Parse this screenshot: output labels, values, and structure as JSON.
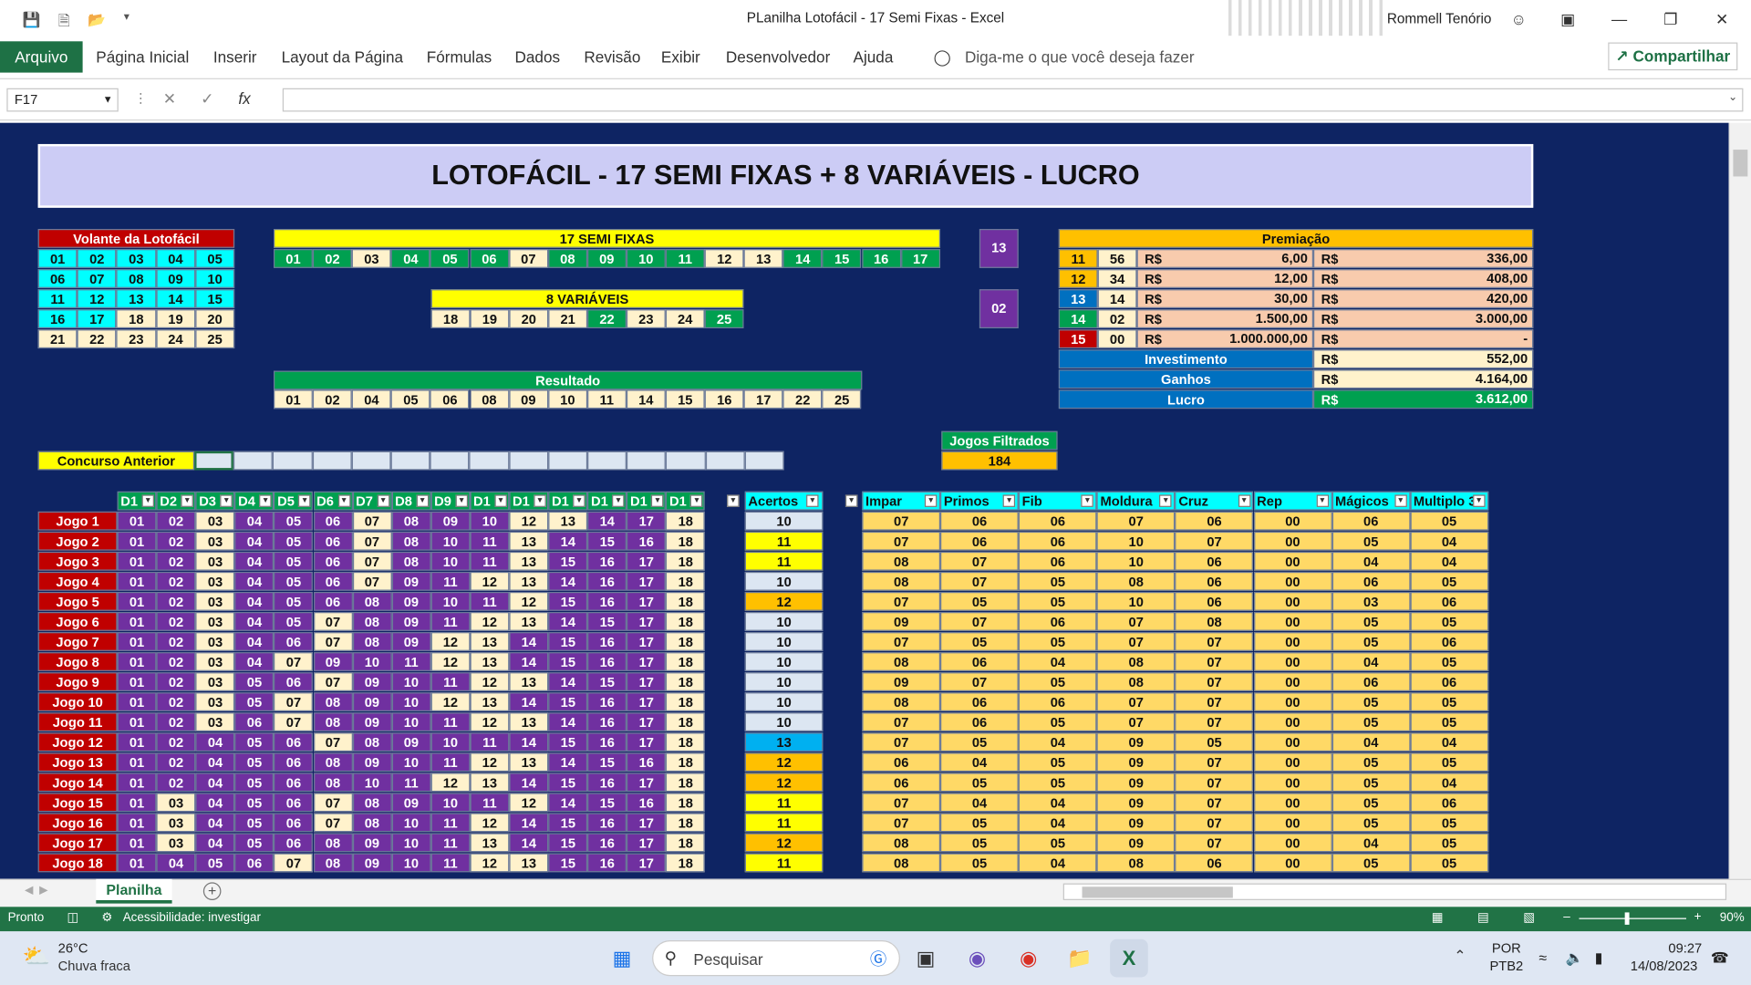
{
  "window": {
    "title": "PLanilha Lotofácil - 17 Semi Fixas  -  Excel",
    "user": "Rommell Tenório"
  },
  "ribbon": {
    "tabs": [
      "Arquivo",
      "Página Inicial",
      "Inserir",
      "Layout da Página",
      "Fórmulas",
      "Dados",
      "Revisão",
      "Exibir",
      "Desenvolvedor",
      "Ajuda"
    ],
    "tell_me": "Diga-me o que você deseja fazer",
    "share": "Compartilhar"
  },
  "formula_bar": {
    "name_box": "F17",
    "fx": "fx",
    "content": ""
  },
  "banner": "LOTOFÁCIL - 17 SEMI FIXAS + 8 VARIÁVEIS - LUCRO",
  "volante": {
    "title": "Volante da Lotofácil",
    "rows": [
      [
        "01",
        "02",
        "03",
        "04",
        "05"
      ],
      [
        "06",
        "07",
        "08",
        "09",
        "10"
      ],
      [
        "11",
        "12",
        "13",
        "14",
        "15"
      ],
      [
        "16",
        "17",
        "18",
        "19",
        "20"
      ],
      [
        "21",
        "22",
        "23",
        "24",
        "25"
      ]
    ],
    "colors": [
      [
        "c",
        "c",
        "c",
        "c",
        "c"
      ],
      [
        "c",
        "c",
        "c",
        "c",
        "c"
      ],
      [
        "c",
        "c",
        "c",
        "c",
        "c"
      ],
      [
        "c",
        "c",
        "l",
        "l",
        "l"
      ],
      [
        "l",
        "l",
        "l",
        "l",
        "l"
      ]
    ]
  },
  "semi_fixas": {
    "title": "17 SEMI FIXAS",
    "numbers": [
      "01",
      "02",
      "03",
      "04",
      "05",
      "06",
      "07",
      "08",
      "09",
      "10",
      "11",
      "12",
      "13",
      "14",
      "15",
      "16",
      "17"
    ],
    "colors": [
      "g",
      "g",
      "l",
      "g",
      "g",
      "g",
      "l",
      "g",
      "g",
      "g",
      "g",
      "l",
      "l",
      "g",
      "g",
      "g",
      "g"
    ]
  },
  "variaveis": {
    "title": "8 VARIÁVEIS",
    "numbers": [
      "18",
      "19",
      "20",
      "21",
      "22",
      "23",
      "24",
      "25"
    ],
    "colors": [
      "l",
      "l",
      "l",
      "l",
      "g",
      "l",
      "l",
      "g"
    ]
  },
  "resultado": {
    "title": "Resultado",
    "numbers": [
      "01",
      "02",
      "04",
      "05",
      "06",
      "08",
      "09",
      "10",
      "11",
      "14",
      "15",
      "16",
      "17",
      "22",
      "25"
    ]
  },
  "side_counts": {
    "a": "13",
    "b": "02"
  },
  "premiacao": {
    "title": "Premiação",
    "rows": [
      {
        "hits": "11",
        "qty": "56",
        "cur1": "R$",
        "prize": "6,00",
        "cur2": "R$",
        "total": "336,00",
        "color": "orange"
      },
      {
        "hits": "12",
        "qty": "34",
        "cur1": "R$",
        "prize": "12,00",
        "cur2": "R$",
        "total": "408,00",
        "color": "orange"
      },
      {
        "hits": "13",
        "qty": "14",
        "cur1": "R$",
        "prize": "30,00",
        "cur2": "R$",
        "total": "420,00",
        "color": "blue"
      },
      {
        "hits": "14",
        "qty": "02",
        "cur1": "R$",
        "prize": "1.500,00",
        "cur2": "R$",
        "total": "3.000,00",
        "color": "green"
      },
      {
        "hits": "15",
        "qty": "00",
        "cur1": "R$",
        "prize": "1.000.000,00",
        "cur2": "R$",
        "total": "-",
        "color": "red"
      }
    ],
    "summary": [
      {
        "label": "Investimento",
        "cur": "R$",
        "value": "552,00"
      },
      {
        "label": "Ganhos",
        "cur": "R$",
        "value": "4.164,00"
      },
      {
        "label": "Lucro",
        "cur": "R$",
        "value": "3.612,00"
      }
    ]
  },
  "jogos_filtrados": {
    "label": "Jogos Filtrados",
    "value": "184"
  },
  "concurso_anterior": "Concurso Anterior",
  "table": {
    "d_headers": [
      "D1",
      "D2",
      "D3",
      "D4",
      "D5",
      "D6",
      "D7",
      "D8",
      "D9",
      "D1",
      "D1",
      "D1",
      "D1",
      "D1",
      "D1"
    ],
    "acertos_header": "Acertos",
    "stat_headers": [
      "Impar",
      "Primos",
      "Fib",
      "Moldura",
      "Cruz",
      "Rep",
      "Mágicos",
      "Multiplo 3"
    ],
    "rows": [
      {
        "jogo": "Jogo 1",
        "d": [
          "01",
          "02",
          "03",
          "04",
          "05",
          "06",
          "07",
          "08",
          "09",
          "10",
          "12",
          "13",
          "14",
          "17",
          "18"
        ],
        "acertos": "10",
        "stats": [
          "07",
          "06",
          "06",
          "07",
          "06",
          "00",
          "06",
          "05"
        ]
      },
      {
        "jogo": "Jogo 2",
        "d": [
          "01",
          "02",
          "03",
          "04",
          "05",
          "06",
          "07",
          "08",
          "10",
          "11",
          "13",
          "14",
          "15",
          "16",
          "18"
        ],
        "acertos": "11",
        "stats": [
          "07",
          "06",
          "06",
          "10",
          "07",
          "00",
          "05",
          "04"
        ]
      },
      {
        "jogo": "Jogo 3",
        "d": [
          "01",
          "02",
          "03",
          "04",
          "05",
          "06",
          "07",
          "08",
          "10",
          "11",
          "13",
          "15",
          "16",
          "17",
          "18"
        ],
        "acertos": "11",
        "stats": [
          "08",
          "07",
          "06",
          "10",
          "06",
          "00",
          "04",
          "04"
        ]
      },
      {
        "jogo": "Jogo 4",
        "d": [
          "01",
          "02",
          "03",
          "04",
          "05",
          "06",
          "07",
          "09",
          "11",
          "12",
          "13",
          "14",
          "16",
          "17",
          "18"
        ],
        "acertos": "10",
        "stats": [
          "08",
          "07",
          "05",
          "08",
          "06",
          "00",
          "06",
          "05"
        ]
      },
      {
        "jogo": "Jogo 5",
        "d": [
          "01",
          "02",
          "03",
          "04",
          "05",
          "06",
          "08",
          "09",
          "10",
          "11",
          "12",
          "15",
          "16",
          "17",
          "18"
        ],
        "acertos": "12",
        "stats": [
          "07",
          "05",
          "05",
          "10",
          "06",
          "00",
          "03",
          "06"
        ]
      },
      {
        "jogo": "Jogo 6",
        "d": [
          "01",
          "02",
          "03",
          "04",
          "05",
          "07",
          "08",
          "09",
          "11",
          "12",
          "13",
          "14",
          "15",
          "17",
          "18"
        ],
        "acertos": "10",
        "stats": [
          "09",
          "07",
          "06",
          "07",
          "08",
          "00",
          "05",
          "05"
        ]
      },
      {
        "jogo": "Jogo 7",
        "d": [
          "01",
          "02",
          "03",
          "04",
          "06",
          "07",
          "08",
          "09",
          "12",
          "13",
          "14",
          "15",
          "16",
          "17",
          "18"
        ],
        "acertos": "10",
        "stats": [
          "07",
          "05",
          "05",
          "07",
          "07",
          "00",
          "05",
          "06"
        ]
      },
      {
        "jogo": "Jogo 8",
        "d": [
          "01",
          "02",
          "03",
          "04",
          "07",
          "09",
          "10",
          "11",
          "12",
          "13",
          "14",
          "15",
          "16",
          "17",
          "18"
        ],
        "acertos": "10",
        "stats": [
          "08",
          "06",
          "04",
          "08",
          "07",
          "00",
          "04",
          "05"
        ]
      },
      {
        "jogo": "Jogo 9",
        "d": [
          "01",
          "02",
          "03",
          "05",
          "06",
          "07",
          "09",
          "10",
          "11",
          "12",
          "13",
          "14",
          "15",
          "17",
          "18"
        ],
        "acertos": "10",
        "stats": [
          "09",
          "07",
          "05",
          "08",
          "07",
          "00",
          "06",
          "06"
        ]
      },
      {
        "jogo": "Jogo 10",
        "d": [
          "01",
          "02",
          "03",
          "05",
          "07",
          "08",
          "09",
          "10",
          "12",
          "13",
          "14",
          "15",
          "16",
          "17",
          "18"
        ],
        "acertos": "10",
        "stats": [
          "08",
          "06",
          "06",
          "07",
          "07",
          "00",
          "05",
          "05"
        ]
      },
      {
        "jogo": "Jogo 11",
        "d": [
          "01",
          "02",
          "03",
          "06",
          "07",
          "08",
          "09",
          "10",
          "11",
          "12",
          "13",
          "14",
          "16",
          "17",
          "18"
        ],
        "acertos": "10",
        "stats": [
          "07",
          "06",
          "05",
          "07",
          "07",
          "00",
          "05",
          "05"
        ]
      },
      {
        "jogo": "Jogo 12",
        "d": [
          "01",
          "02",
          "04",
          "05",
          "06",
          "07",
          "08",
          "09",
          "10",
          "11",
          "14",
          "15",
          "16",
          "17",
          "18"
        ],
        "acertos": "13",
        "stats": [
          "07",
          "05",
          "04",
          "09",
          "05",
          "00",
          "04",
          "04"
        ]
      },
      {
        "jogo": "Jogo 13",
        "d": [
          "01",
          "02",
          "04",
          "05",
          "06",
          "08",
          "09",
          "10",
          "11",
          "12",
          "13",
          "14",
          "15",
          "16",
          "18"
        ],
        "acertos": "12",
        "stats": [
          "06",
          "04",
          "05",
          "09",
          "07",
          "00",
          "05",
          "05"
        ]
      },
      {
        "jogo": "Jogo 14",
        "d": [
          "01",
          "02",
          "04",
          "05",
          "06",
          "08",
          "10",
          "11",
          "12",
          "13",
          "14",
          "15",
          "16",
          "17",
          "18"
        ],
        "acertos": "12",
        "stats": [
          "06",
          "05",
          "05",
          "09",
          "07",
          "00",
          "05",
          "04"
        ]
      },
      {
        "jogo": "Jogo 15",
        "d": [
          "01",
          "03",
          "04",
          "05",
          "06",
          "07",
          "08",
          "09",
          "10",
          "11",
          "12",
          "14",
          "15",
          "16",
          "18"
        ],
        "acertos": "11",
        "stats": [
          "07",
          "04",
          "04",
          "09",
          "07",
          "00",
          "05",
          "06"
        ]
      },
      {
        "jogo": "Jogo 16",
        "d": [
          "01",
          "03",
          "04",
          "05",
          "06",
          "07",
          "08",
          "10",
          "11",
          "12",
          "14",
          "15",
          "16",
          "17",
          "18"
        ],
        "acertos": "11",
        "stats": [
          "07",
          "05",
          "04",
          "09",
          "07",
          "00",
          "05",
          "05"
        ]
      },
      {
        "jogo": "Jogo 17",
        "d": [
          "01",
          "03",
          "04",
          "05",
          "06",
          "08",
          "09",
          "10",
          "11",
          "13",
          "14",
          "15",
          "16",
          "17",
          "18"
        ],
        "acertos": "12",
        "stats": [
          "08",
          "05",
          "05",
          "09",
          "07",
          "00",
          "04",
          "05"
        ]
      },
      {
        "jogo": "Jogo 18",
        "d": [
          "01",
          "04",
          "05",
          "06",
          "07",
          "08",
          "09",
          "10",
          "11",
          "12",
          "13",
          "15",
          "16",
          "17",
          "18"
        ],
        "acertos": "11",
        "stats": [
          "08",
          "05",
          "04",
          "08",
          "06",
          "00",
          "05",
          "05"
        ]
      }
    ]
  },
  "sheet_tab": "Planilha",
  "status": {
    "ready": "Pronto",
    "accessibility": "Acessibilidade: investigar",
    "zoom": "90%"
  },
  "taskbar": {
    "weather_temp": "26°C",
    "weather_desc": "Chuva fraca",
    "search": "Pesquisar",
    "lang1": "POR",
    "lang2": "PTB2",
    "time": "09:27",
    "date": "14/08/2023"
  },
  "colors": {
    "sheet_bg": "#0e2463",
    "excel_green": "#217346",
    "purple": "#7030a0",
    "green": "#00a050",
    "cyan": "#00ffff",
    "light": "#fff2cc"
  }
}
